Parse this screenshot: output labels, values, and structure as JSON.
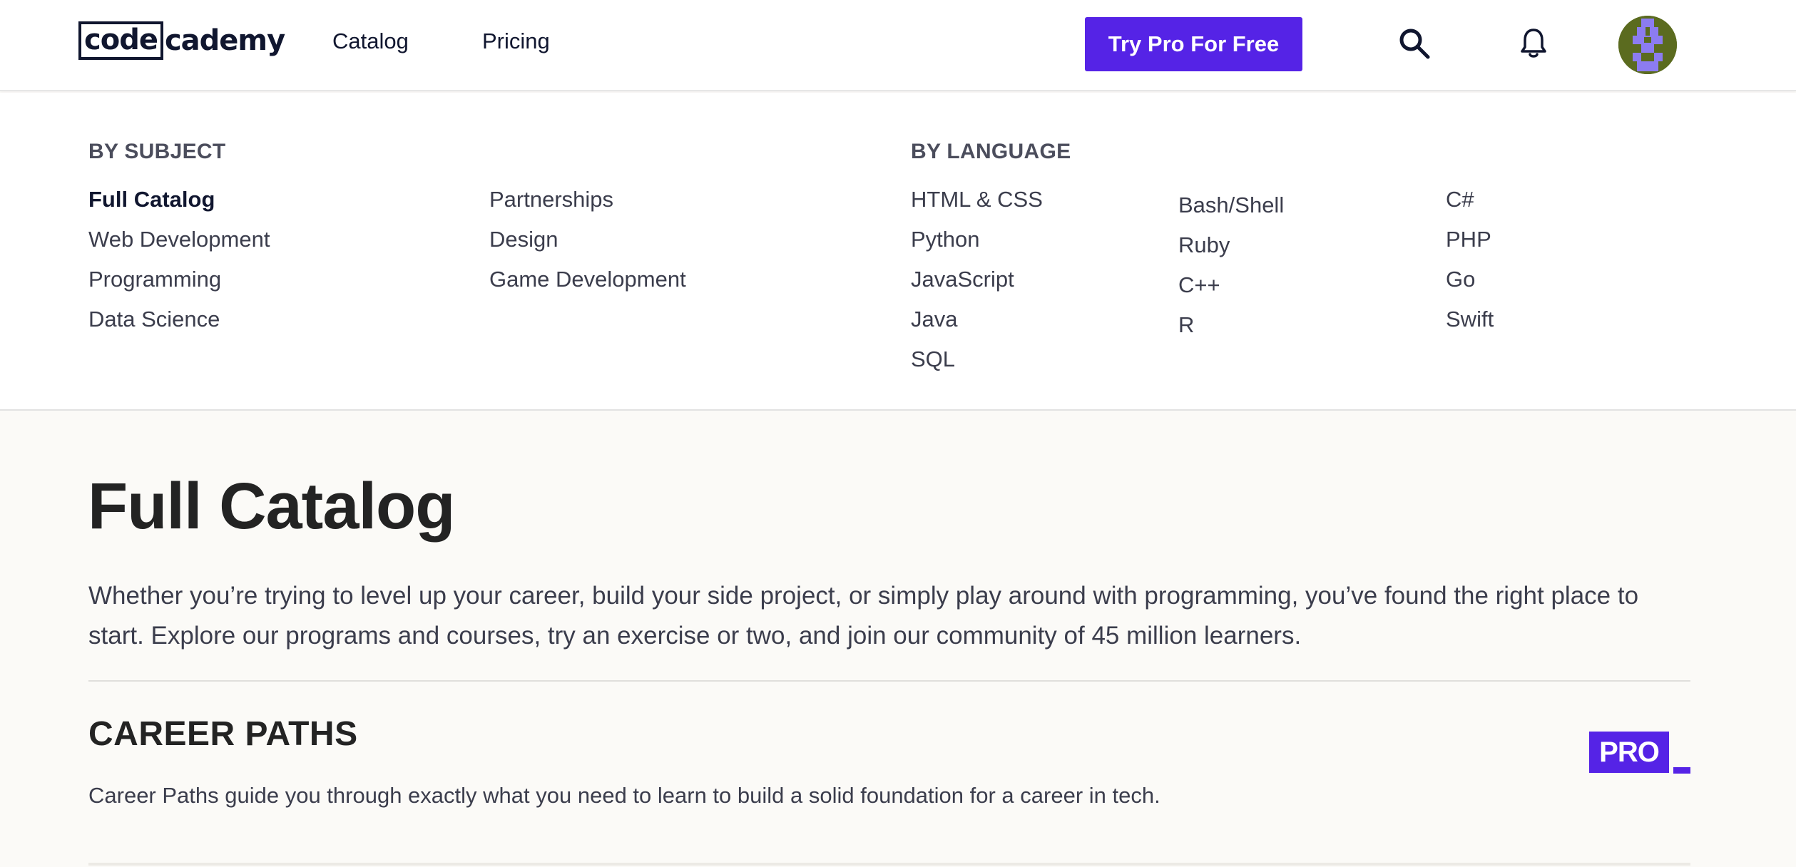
{
  "header": {
    "logo_left": "code",
    "logo_right": "cademy",
    "nav": [
      "Catalog",
      "Pricing"
    ],
    "cta_label": "Try Pro For Free",
    "accent_color": "#5523e6",
    "icons": [
      "search-icon",
      "bell-icon",
      "avatar"
    ]
  },
  "menu": {
    "subject_heading": "BY SUBJECT",
    "language_heading": "BY LANGUAGE",
    "subject_col1": [
      "Full Catalog",
      "Web Development",
      "Programming",
      "Data Science"
    ],
    "subject_col2": [
      "Partnerships",
      "Design",
      "Game Development"
    ],
    "language_col1": [
      "HTML & CSS",
      "Python",
      "JavaScript",
      "Java",
      "SQL"
    ],
    "language_col2": [
      "Bash/Shell",
      "Ruby",
      "C++",
      "R"
    ],
    "language_col3": [
      "C#",
      "PHP",
      "Go",
      "Swift"
    ],
    "active_item": "Full Catalog"
  },
  "main": {
    "title": "Full Catalog",
    "intro": "Whether you’re trying to level up your career, build your side project, or simply play around with programming, you’ve found the right place to start. Explore our programs and courses, try an exercise or two, and join our community of 45 million learners.",
    "section_title": "CAREER PATHS",
    "section_desc": "Career Paths guide you through exactly what you need to learn to build a solid foundation for a career in tech.",
    "badge": "PRO"
  }
}
